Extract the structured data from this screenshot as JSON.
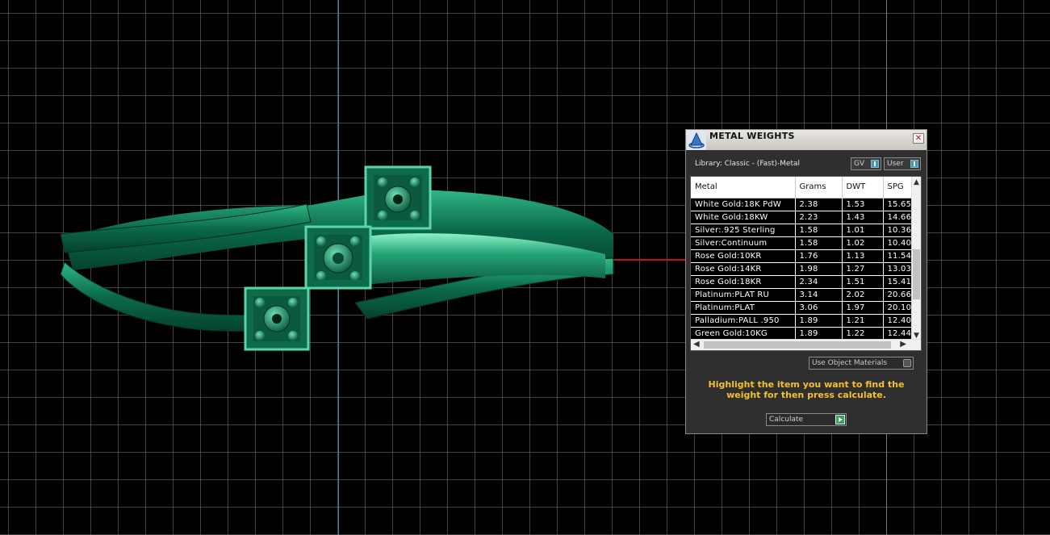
{
  "dialog": {
    "title": "METAL WEIGHTS",
    "close_symbol": "✕",
    "library_label": "Library: Classic - (Fast)-Metal",
    "toggles": {
      "gv": "GV",
      "user": "User"
    },
    "columns": [
      "Metal",
      "Grams",
      "DWT",
      "SPG"
    ],
    "rows": [
      [
        "White Gold:18K PdW",
        "2.38",
        "1.53",
        "15.65"
      ],
      [
        "White Gold:18KW",
        "2.23",
        "1.43",
        "14.66"
      ],
      [
        "Silver:.925 Sterling",
        "1.58",
        "1.01",
        "10.36"
      ],
      [
        "Silver:Continuum",
        "1.58",
        "1.02",
        "10.40"
      ],
      [
        "Rose Gold:10KR",
        "1.76",
        "1.13",
        "11.54"
      ],
      [
        "Rose Gold:14KR",
        "1.98",
        "1.27",
        "13.03"
      ],
      [
        "Rose Gold:18KR",
        "2.34",
        "1.51",
        "15.41"
      ],
      [
        "Platinum:PLAT RU",
        "3.14",
        "2.02",
        "20.66"
      ],
      [
        "Platinum:PLAT",
        "3.06",
        "1.97",
        "20.10"
      ],
      [
        "Palladium:PALL .950",
        "1.89",
        "1.21",
        "12.40"
      ],
      [
        "Green Gold:10KG",
        "1.89",
        "1.22",
        "12.44"
      ]
    ],
    "use_object_materials": "Use Object Materials",
    "hint": "Highlight the item you want to find the weight for then press calculate.",
    "calculate_label": "Calculate",
    "icons": {
      "app": "rhino-app-icon",
      "close": "close-icon",
      "scroll_up": "▲",
      "scroll_down": "▼",
      "scroll_left": "◀",
      "scroll_right": "▶"
    }
  },
  "viewport": {
    "colors": {
      "background": "#000000",
      "grid": "#787878",
      "model": "#0f7a57",
      "x_axis": "#c01616",
      "y_axis": "#2c8fb5"
    }
  }
}
